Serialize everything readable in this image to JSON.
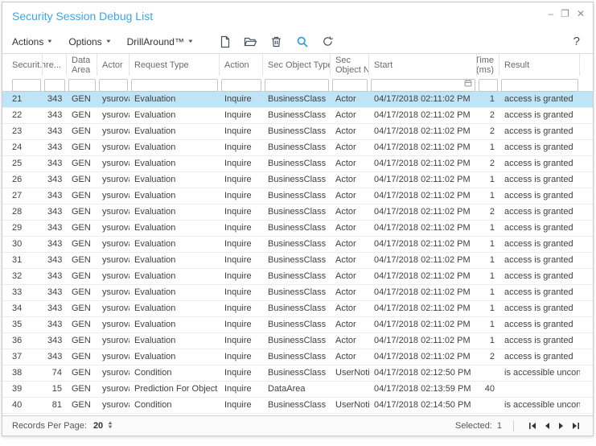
{
  "window": {
    "title": "Security Session Debug List",
    "controls": {
      "minimize": "–",
      "maximize": "❐",
      "close": "✕"
    }
  },
  "toolbar": {
    "menus": [
      {
        "label": "Actions"
      },
      {
        "label": "Options"
      },
      {
        "label": "DrillAround™"
      }
    ],
    "icons": [
      "new-document-icon",
      "open-folder-icon",
      "delete-icon",
      "search-icon",
      "refresh-icon"
    ],
    "help_label": "?"
  },
  "table": {
    "columns": [
      {
        "key": "security",
        "label": "Securit...",
        "align": "left"
      },
      {
        "key": "thread",
        "label": "Thre...",
        "align": "right"
      },
      {
        "key": "data_area",
        "label": "Data\nArea",
        "align": "left"
      },
      {
        "key": "actor",
        "label": "Actor",
        "align": "left"
      },
      {
        "key": "request_type",
        "label": "Request Type",
        "align": "left"
      },
      {
        "key": "action",
        "label": "Action",
        "align": "left"
      },
      {
        "key": "sec_object_type",
        "label": "Sec Object Type",
        "align": "left"
      },
      {
        "key": "sec_object_name",
        "label": "Sec\nObject Na...",
        "align": "left"
      },
      {
        "key": "start",
        "label": "Start",
        "align": "left",
        "has_calendar": true
      },
      {
        "key": "time_ms",
        "label": "Time\n(ms)",
        "align": "right"
      },
      {
        "key": "result",
        "label": "Result",
        "align": "left"
      },
      {
        "key": "",
        "label": "",
        "align": "left"
      }
    ],
    "rows": [
      {
        "security": "21",
        "thread": "343",
        "data_area": "GEN",
        "actor": "ysurova",
        "request_type": "Evaluation",
        "action": "Inquire",
        "sec_object_type": "BusinessClass",
        "sec_object_name": "Actor",
        "start": "04/17/2018 02:11:02 PM",
        "time_ms": "1",
        "result": "access is granted",
        "selected": true
      },
      {
        "security": "22",
        "thread": "343",
        "data_area": "GEN",
        "actor": "ysurova",
        "request_type": "Evaluation",
        "action": "Inquire",
        "sec_object_type": "BusinessClass",
        "sec_object_name": "Actor",
        "start": "04/17/2018 02:11:02 PM",
        "time_ms": "2",
        "result": "access is granted"
      },
      {
        "security": "23",
        "thread": "343",
        "data_area": "GEN",
        "actor": "ysurova",
        "request_type": "Evaluation",
        "action": "Inquire",
        "sec_object_type": "BusinessClass",
        "sec_object_name": "Actor",
        "start": "04/17/2018 02:11:02 PM",
        "time_ms": "2",
        "result": "access is granted"
      },
      {
        "security": "24",
        "thread": "343",
        "data_area": "GEN",
        "actor": "ysurova",
        "request_type": "Evaluation",
        "action": "Inquire",
        "sec_object_type": "BusinessClass",
        "sec_object_name": "Actor",
        "start": "04/17/2018 02:11:02 PM",
        "time_ms": "1",
        "result": "access is granted"
      },
      {
        "security": "25",
        "thread": "343",
        "data_area": "GEN",
        "actor": "ysurova",
        "request_type": "Evaluation",
        "action": "Inquire",
        "sec_object_type": "BusinessClass",
        "sec_object_name": "Actor",
        "start": "04/17/2018 02:11:02 PM",
        "time_ms": "2",
        "result": "access is granted"
      },
      {
        "security": "26",
        "thread": "343",
        "data_area": "GEN",
        "actor": "ysurova",
        "request_type": "Evaluation",
        "action": "Inquire",
        "sec_object_type": "BusinessClass",
        "sec_object_name": "Actor",
        "start": "04/17/2018 02:11:02 PM",
        "time_ms": "1",
        "result": "access is granted"
      },
      {
        "security": "27",
        "thread": "343",
        "data_area": "GEN",
        "actor": "ysurova",
        "request_type": "Evaluation",
        "action": "Inquire",
        "sec_object_type": "BusinessClass",
        "sec_object_name": "Actor",
        "start": "04/17/2018 02:11:02 PM",
        "time_ms": "1",
        "result": "access is granted"
      },
      {
        "security": "28",
        "thread": "343",
        "data_area": "GEN",
        "actor": "ysurova",
        "request_type": "Evaluation",
        "action": "Inquire",
        "sec_object_type": "BusinessClass",
        "sec_object_name": "Actor",
        "start": "04/17/2018 02:11:02 PM",
        "time_ms": "2",
        "result": "access is granted"
      },
      {
        "security": "29",
        "thread": "343",
        "data_area": "GEN",
        "actor": "ysurova",
        "request_type": "Evaluation",
        "action": "Inquire",
        "sec_object_type": "BusinessClass",
        "sec_object_name": "Actor",
        "start": "04/17/2018 02:11:02 PM",
        "time_ms": "1",
        "result": "access is granted"
      },
      {
        "security": "30",
        "thread": "343",
        "data_area": "GEN",
        "actor": "ysurova",
        "request_type": "Evaluation",
        "action": "Inquire",
        "sec_object_type": "BusinessClass",
        "sec_object_name": "Actor",
        "start": "04/17/2018 02:11:02 PM",
        "time_ms": "1",
        "result": "access is granted"
      },
      {
        "security": "31",
        "thread": "343",
        "data_area": "GEN",
        "actor": "ysurova",
        "request_type": "Evaluation",
        "action": "Inquire",
        "sec_object_type": "BusinessClass",
        "sec_object_name": "Actor",
        "start": "04/17/2018 02:11:02 PM",
        "time_ms": "1",
        "result": "access is granted"
      },
      {
        "security": "32",
        "thread": "343",
        "data_area": "GEN",
        "actor": "ysurova",
        "request_type": "Evaluation",
        "action": "Inquire",
        "sec_object_type": "BusinessClass",
        "sec_object_name": "Actor",
        "start": "04/17/2018 02:11:02 PM",
        "time_ms": "1",
        "result": "access is granted"
      },
      {
        "security": "33",
        "thread": "343",
        "data_area": "GEN",
        "actor": "ysurova",
        "request_type": "Evaluation",
        "action": "Inquire",
        "sec_object_type": "BusinessClass",
        "sec_object_name": "Actor",
        "start": "04/17/2018 02:11:02 PM",
        "time_ms": "1",
        "result": "access is granted"
      },
      {
        "security": "34",
        "thread": "343",
        "data_area": "GEN",
        "actor": "ysurova",
        "request_type": "Evaluation",
        "action": "Inquire",
        "sec_object_type": "BusinessClass",
        "sec_object_name": "Actor",
        "start": "04/17/2018 02:11:02 PM",
        "time_ms": "1",
        "result": "access is granted"
      },
      {
        "security": "35",
        "thread": "343",
        "data_area": "GEN",
        "actor": "ysurova",
        "request_type": "Evaluation",
        "action": "Inquire",
        "sec_object_type": "BusinessClass",
        "sec_object_name": "Actor",
        "start": "04/17/2018 02:11:02 PM",
        "time_ms": "1",
        "result": "access is granted"
      },
      {
        "security": "36",
        "thread": "343",
        "data_area": "GEN",
        "actor": "ysurova",
        "request_type": "Evaluation",
        "action": "Inquire",
        "sec_object_type": "BusinessClass",
        "sec_object_name": "Actor",
        "start": "04/17/2018 02:11:02 PM",
        "time_ms": "1",
        "result": "access is granted"
      },
      {
        "security": "37",
        "thread": "343",
        "data_area": "GEN",
        "actor": "ysurova",
        "request_type": "Evaluation",
        "action": "Inquire",
        "sec_object_type": "BusinessClass",
        "sec_object_name": "Actor",
        "start": "04/17/2018 02:11:02 PM",
        "time_ms": "2",
        "result": "access is granted"
      },
      {
        "security": "38",
        "thread": "74",
        "data_area": "GEN",
        "actor": "ysurova",
        "request_type": "Condition",
        "action": "Inquire",
        "sec_object_type": "BusinessClass",
        "sec_object_name": "UserNotif...",
        "start": "04/17/2018 02:12:50 PM",
        "time_ms": "",
        "result": "is accessible unconditio..."
      },
      {
        "security": "39",
        "thread": "15",
        "data_area": "GEN",
        "actor": "ysurova",
        "request_type": "Prediction For Object Type",
        "action": "Inquire",
        "sec_object_type": "DataArea",
        "sec_object_name": "",
        "start": "04/17/2018 02:13:59 PM",
        "time_ms": "40",
        "result": ""
      },
      {
        "security": "40",
        "thread": "81",
        "data_area": "GEN",
        "actor": "ysurova",
        "request_type": "Condition",
        "action": "Inquire",
        "sec_object_type": "BusinessClass",
        "sec_object_name": "UserNotif...",
        "start": "04/17/2018 02:14:50 PM",
        "time_ms": "",
        "result": "is accessible unconditio..."
      }
    ]
  },
  "footer": {
    "records_per_page_label": "Records Per Page:",
    "records_per_page_value": "20",
    "selected_label": "Selected:",
    "selected_value": "1",
    "nav_icons": [
      "first-page-icon",
      "previous-page-icon",
      "next-page-icon",
      "last-page-icon"
    ]
  },
  "colors": {
    "title_blue": "#3fa5e0",
    "selected_row": "#bee4f8",
    "search_icon_blue": "#2d9ee2",
    "header_text": "#6b6b6b",
    "body_text": "#404040"
  }
}
